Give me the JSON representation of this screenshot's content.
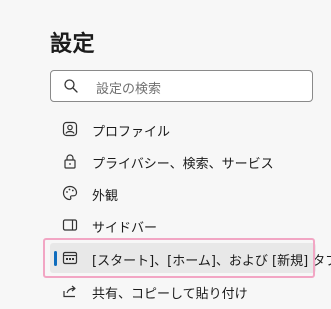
{
  "title": "設定",
  "search": {
    "placeholder": "設定の検索",
    "icon": "search-icon"
  },
  "nav": {
    "items": [
      {
        "label": "プロファイル",
        "icon": "profile-icon"
      },
      {
        "label": "プライバシー、検索、サービス",
        "icon": "lock-icon"
      },
      {
        "label": "外観",
        "icon": "palette-icon"
      },
      {
        "label": "サイドバー",
        "icon": "sidebar-icon"
      },
      {
        "label": "[スタート]、[ホーム]、および [新規] タブ",
        "icon": "home-tabs-icon",
        "selected": true
      },
      {
        "label": "共有、コピーして貼り付け",
        "icon": "share-icon"
      }
    ]
  },
  "colors": {
    "accent": "#0f6cbd",
    "highlight": "#f2a6c4",
    "background": "#f7f7f7"
  }
}
